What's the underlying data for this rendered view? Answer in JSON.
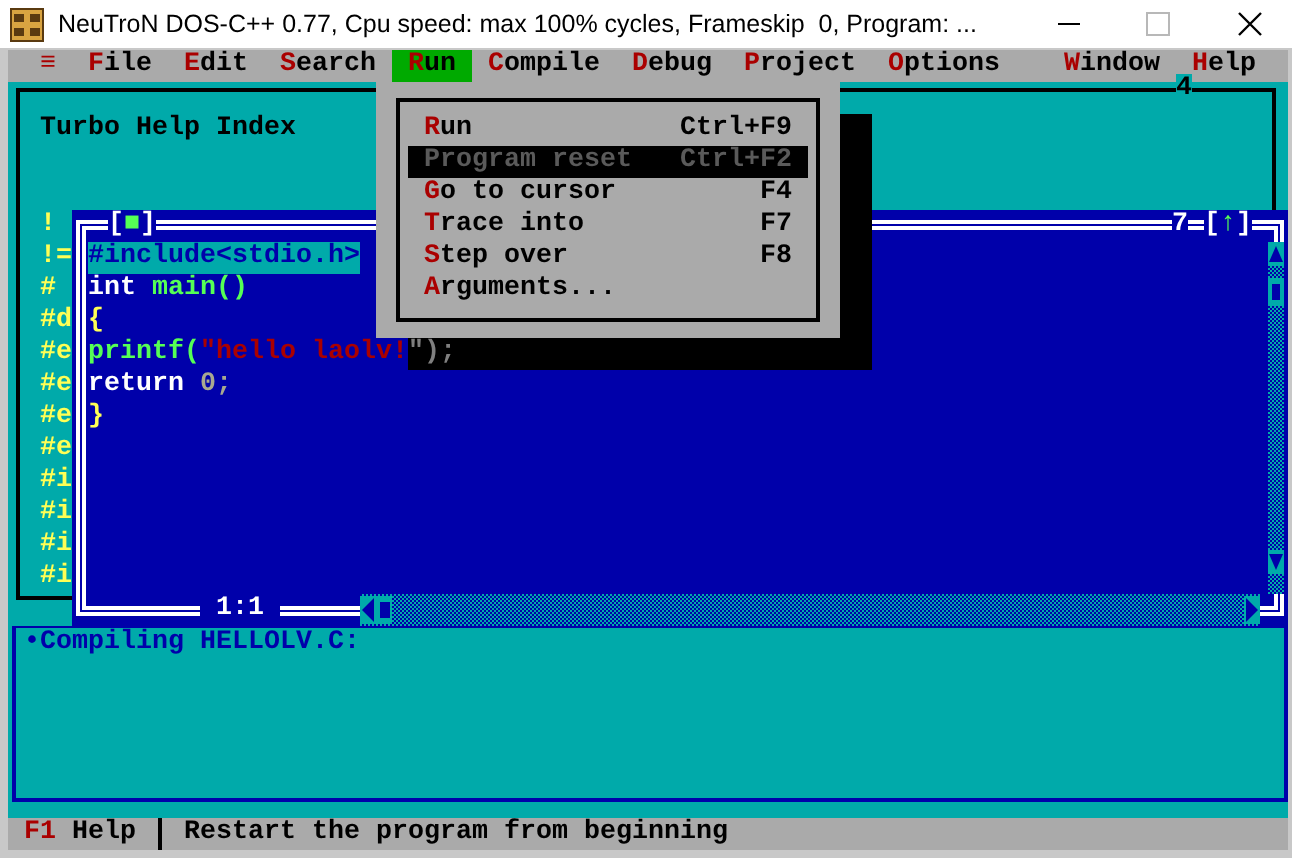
{
  "window": {
    "title": "NeuTroN DOS-C++ 0.77, Cpu speed: max 100% cycles, Frameskip  0, Program: ..."
  },
  "menu_bar": {
    "items": [
      {
        "label": "≡",
        "selected": false
      },
      {
        "label": "File",
        "selected": false
      },
      {
        "label": "Edit",
        "selected": false
      },
      {
        "label": "Search",
        "selected": false
      },
      {
        "label": "Run",
        "selected": true
      },
      {
        "label": "Compile",
        "selected": false
      },
      {
        "label": "Debug",
        "selected": false
      },
      {
        "label": "Project",
        "selected": false
      },
      {
        "label": "Options",
        "selected": false
      }
    ],
    "right_items": [
      {
        "label": "Window",
        "selected": false
      },
      {
        "label": "Help",
        "selected": false
      }
    ]
  },
  "help_window": {
    "number": "4",
    "title": "Turbo Help Index",
    "lines": [
      "!",
      "!=",
      "#",
      "#d",
      "#e",
      "#e",
      "#e",
      "#e",
      "#i",
      "#i",
      "#i",
      "#i"
    ]
  },
  "editor": {
    "close_box": "[■]",
    "number": "7",
    "zoom_box": "[↑]",
    "position": "1:1",
    "lines": [
      {
        "selected": true,
        "tokens": [
          {
            "text": "#include<stdio.h>",
            "kind": "plain"
          }
        ]
      },
      {
        "selected": false,
        "tokens": [
          {
            "text": "int ",
            "kind": "plain"
          },
          {
            "text": "main()",
            "kind": "function"
          }
        ]
      },
      {
        "selected": false,
        "tokens": [
          {
            "text": "{",
            "kind": "symbol"
          }
        ]
      },
      {
        "selected": false,
        "tokens": [
          {
            "text": "printf(",
            "kind": "function"
          },
          {
            "text": "\"hello laolv!",
            "kind": "string"
          },
          {
            "text": "\");",
            "kind": "shadowed"
          }
        ]
      },
      {
        "selected": false,
        "tokens": [
          {
            "text": "return ",
            "kind": "plain"
          },
          {
            "text": "0;",
            "kind": "number"
          }
        ]
      },
      {
        "selected": false,
        "tokens": [
          {
            "text": "}",
            "kind": "symbol"
          }
        ]
      }
    ]
  },
  "run_menu": {
    "items": [
      {
        "label": "Run",
        "shortcut": "Ctrl+F9",
        "selected": false,
        "disabled": false
      },
      {
        "label": "Program reset",
        "shortcut": "Ctrl+F2",
        "selected": true,
        "disabled": true
      },
      {
        "label": "Go to cursor",
        "shortcut": "F4",
        "selected": false,
        "disabled": false
      },
      {
        "label": "Trace into",
        "shortcut": "F7",
        "selected": false,
        "disabled": false
      },
      {
        "label": "Step over",
        "shortcut": "F8",
        "selected": false,
        "disabled": false
      },
      {
        "label": "Arguments...",
        "selected": false,
        "disabled": false
      }
    ]
  },
  "message_window": {
    "lines": [
      "•Compiling HELLOLV.C:"
    ]
  },
  "status_bar": {
    "key": "F1",
    "key_label": "Help",
    "message": "Restart the program from beginning"
  }
}
